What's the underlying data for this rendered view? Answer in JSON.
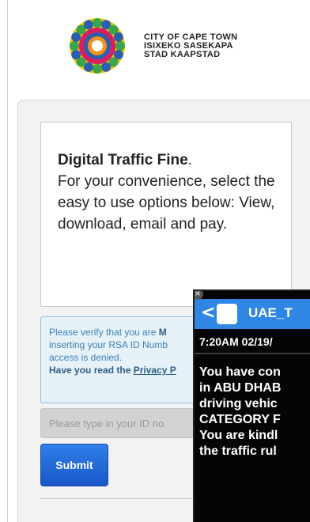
{
  "header": {
    "city_lines": [
      "CITY OF CAPE TOWN",
      "ISIXEKO SASEKAPA",
      "STAD KAAPSTAD"
    ],
    "logo_colors": [
      "#f4c20d",
      "#d61f63",
      "#3aa54a",
      "#2a5fae",
      "#f29219"
    ]
  },
  "intro": {
    "title": "Digital Traffic Fine",
    "title_suffix": ".",
    "body": "For your convenience, select the easy to use options below: View, download, email and pay."
  },
  "notice": {
    "line1_prefix": "Please verify that you are ",
    "line1_bold": "M",
    "line2": "inserting your RSA ID Numb",
    "line3": "access is denied.",
    "line4_prefix": "Have you read the ",
    "line4_link": "Privacy P"
  },
  "form": {
    "id_placeholder": "Please type in your ID no.",
    "submit_label": "Submit"
  },
  "sms": {
    "close_label": "×",
    "back_label": "<",
    "sender": "UAE_T",
    "timestamp": "7:20AM 02/19/",
    "body_lines": [
      "You have con",
      "in ABU DHAB",
      "driving vehic",
      "CATEGORY F",
      "You are kindl",
      "the traffic rul"
    ]
  }
}
